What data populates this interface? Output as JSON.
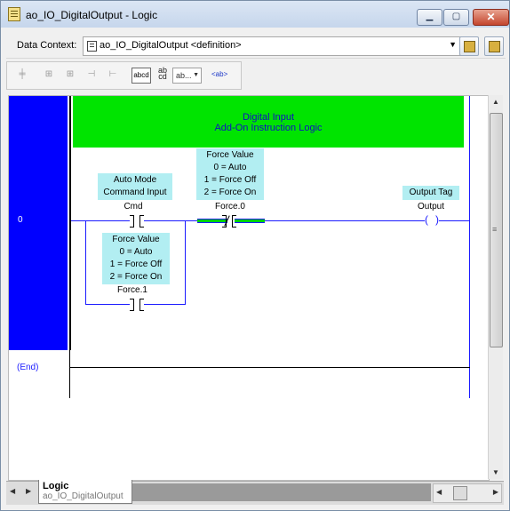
{
  "window": {
    "title": "ao_IO_DigitalOutput - Logic"
  },
  "context": {
    "label": "Data Context:",
    "value": "ao_IO_DigitalOutput <definition>"
  },
  "toolbar": {
    "tool_abcd": "abcd",
    "tool_ab_cd": "ab\ncd",
    "tool_ab_combo": "ab...",
    "tool_ab_tag": "<ab>"
  },
  "rung": {
    "number": "0",
    "comment": [
      "Digital Input",
      "Add-On Instruction Logic"
    ],
    "instructions": [
      {
        "type": "XIC",
        "desc": [
          "Auto Mode",
          "Command Input"
        ],
        "operand": "Cmd"
      },
      {
        "type": "XIO",
        "desc": [
          "Force Value",
          "0 = Auto",
          "1 = Force Off",
          "2 = Force On"
        ],
        "operand": "Force.0"
      },
      {
        "type": "OTE",
        "desc": [
          "Output Tag"
        ],
        "operand": "Output"
      },
      {
        "type": "XIC",
        "branch": true,
        "desc": [
          "Force Value",
          "0 = Auto",
          "1 = Force Off",
          "2 = Force On"
        ],
        "operand": "Force.1"
      }
    ]
  },
  "end_label": "(End)",
  "bottom": {
    "tab_title": "Logic",
    "tab_subtitle": "ao_IO_DigitalOutput"
  },
  "colors": {
    "rung_margin": "#0000ff",
    "comment_bg": "#00e400",
    "tag_desc_bg": "#b2eef2",
    "wire": "#1a1aff",
    "energized": "#00d000"
  },
  "icons": [
    "logic-routine-icon",
    "minimize-icon",
    "maximize-icon",
    "close-icon",
    "data-context-icon",
    "dropdown-arrow-icon",
    "scroll-up-icon",
    "scroll-down-icon",
    "scroll-left-icon",
    "scroll-right-icon"
  ]
}
